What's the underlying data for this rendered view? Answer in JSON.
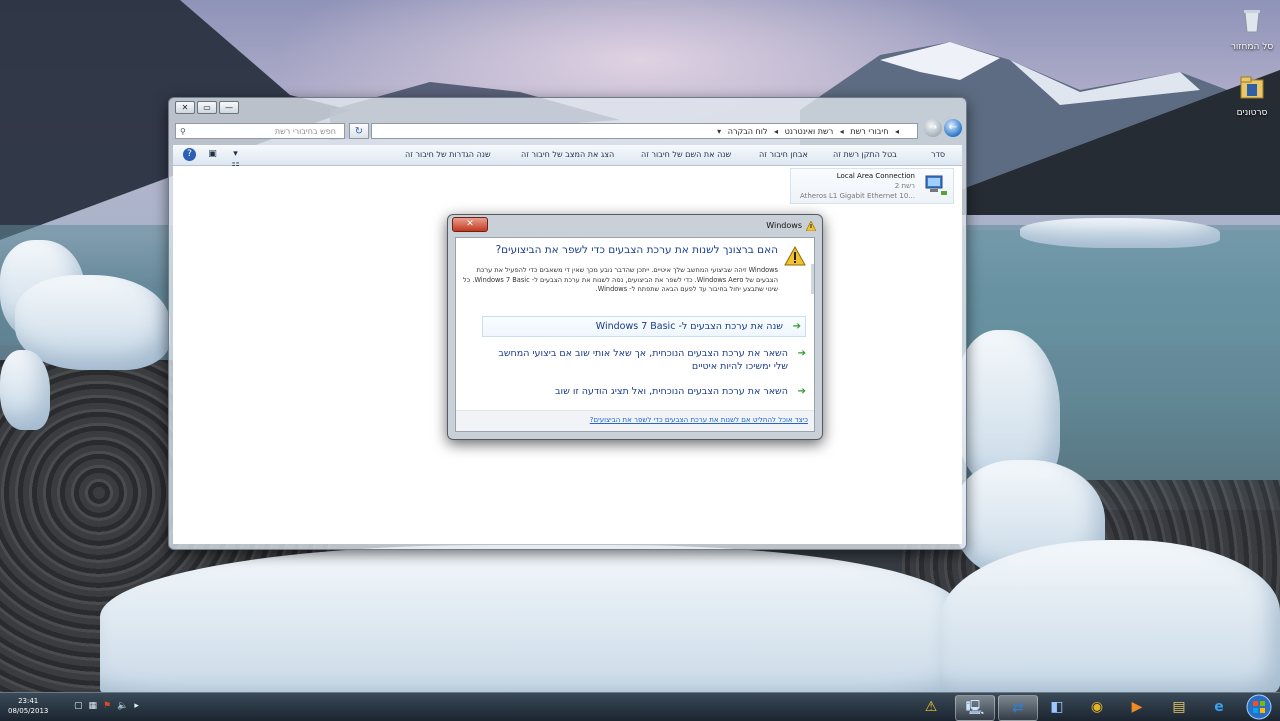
{
  "desktop": {
    "icons": [
      {
        "label": "סל המחזור",
        "icon": "recycle-bin-icon"
      },
      {
        "label": "סרטונים",
        "icon": "folder-icon"
      }
    ]
  },
  "explorer": {
    "caption_buttons": [
      "✕",
      "▭",
      "—"
    ],
    "search_placeholder": "חפש בחיבורי רשת",
    "breadcrumb": [
      "לוח הבקרה",
      "רשת ואינטרנט",
      "חיבורי רשת"
    ],
    "toolbar": {
      "organize": "סדר",
      "disable": "בטל התקן רשת זה",
      "diagnose": "אבחן חיבור זה",
      "rename": "שנה את השם של חיבור זה",
      "status": "הצג את המצב של חיבור זה",
      "change_settings": "שנה הגדרות של חיבור זה"
    },
    "connection": {
      "name": "Local Area Connection",
      "status": "רשת 2",
      "device": "Atheros L1 Gigabit Ethernet 10..."
    }
  },
  "dialog": {
    "title": "Windows",
    "close_label": "✕",
    "question": "האם ברצונך לשנות את ערכת הצבעים כדי לשפר את הביצועים?",
    "description": "Windows זיהה שביצועי המחשב שלך איטיים. ייתכן שהדבר נובע מכך שאין די משאבים כדי להפעיל את ערכת הצבעים של Windows Aero. כדי לשפר את הביצועים, נסה לשנות את ערכת הצבעים ל- Windows 7 Basic. כל שינוי שתבצע יחול בחיבור עד לפעם הבאה שתפתח ל- Windows.",
    "options": [
      "שנה את ערכת הצבעים ל- Windows 7 Basic",
      "השאר את ערכת הצבעים הנוכחית, אך שאל אותי שוב אם ביצועי המחשב שלי ימשיכו להיות איטיים",
      "השאר את ערכת הצבעים הנוכחית, ואל תציג הודעה זו שוב"
    ],
    "footer_link": "כיצד אוכל להחליט אם לשנות את ערכת הצבעים כדי לשפר את הביצועים?"
  },
  "taskbar": {
    "time": "23:41",
    "date": "08/05/2013",
    "tray_icons": [
      "desktop-icon",
      "network-icon",
      "flag-icon",
      "volume-icon",
      "chevron-icon"
    ],
    "apps": [
      {
        "name": "warning-app-icon",
        "glyph": "⚠"
      },
      {
        "name": "network-window-icon",
        "glyph": "🖳"
      },
      {
        "name": "teamviewer-icon",
        "glyph": "⇄"
      },
      {
        "name": "app-window-icon",
        "glyph": "◧"
      },
      {
        "name": "chrome-icon",
        "glyph": "◉"
      },
      {
        "name": "media-player-icon",
        "glyph": "▶"
      },
      {
        "name": "explorer-folder-icon",
        "glyph": "▤"
      },
      {
        "name": "internet-explorer-icon",
        "glyph": "e"
      },
      {
        "name": "start-orb-icon",
        "glyph": "⊞"
      }
    ]
  },
  "colors": {
    "accent": "#1c3d8f",
    "close_red": "#c2381f",
    "taskbar": "#1b2530"
  }
}
